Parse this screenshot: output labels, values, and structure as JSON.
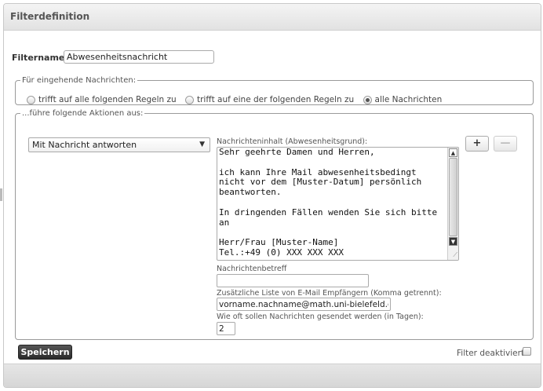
{
  "header": {
    "title": "Filterdefinition"
  },
  "filtername": {
    "label": "Filtername:",
    "value": "Abwesenheitsnachricht"
  },
  "incoming": {
    "legend": "Für eingehende Nachrichten:",
    "options": [
      {
        "label": "trifft auf alle folgenden Regeln zu",
        "checked": false
      },
      {
        "label": "trifft auf eine der folgenden Regeln zu",
        "checked": false
      },
      {
        "label": "alle Nachrichten",
        "checked": true
      }
    ]
  },
  "actions": {
    "legend": "...führe folgende Aktionen aus:",
    "action_select": "Mit Nachricht antworten",
    "add_button": "+",
    "remove_button": "—",
    "body_label": "Nachrichteninhalt (Abwesenheitsgrund):",
    "body_text": "Sehr geehrte Damen und Herren,\n\nich kann Ihre Mail abwesenheitsbedingt nicht vor dem [Muster-Datum] persönlich beantworten.\n\nIn dringenden Fällen wenden Sie sich bitte an\n\nHerr/Frau [Muster-Name]\nTel.:+49 (0) XXX XXX XXX",
    "subject_label": "Nachrichtenbetreff",
    "subject_value": "",
    "recipients_label": "Zusätzliche Liste von E-Mail Empfängern (Komma getrennt):",
    "recipients_value": "vorname.nachname@math.uni-bielefeld.de",
    "days_label": "Wie oft sollen Nachrichten gesendet werden (in Tagen):",
    "days_value": "2"
  },
  "footer": {
    "save_label": "Speichern",
    "deactivate_label": "Filter deaktiviert"
  }
}
